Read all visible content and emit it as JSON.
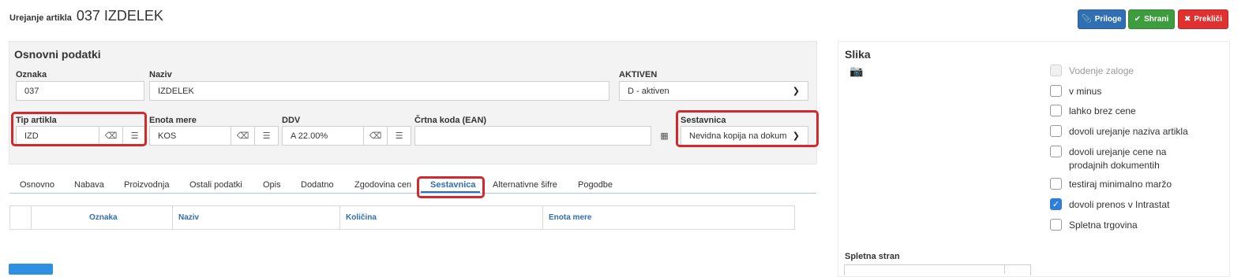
{
  "header": {
    "subtitle": "Urejanje artikla",
    "title": "037 IZDELEK"
  },
  "toolbar": {
    "attachments_label": "Priloge",
    "save_label": "Shrani",
    "cancel_label": "Prekliči"
  },
  "basic": {
    "section_title": "Osnovni podatki",
    "code_label": "Oznaka",
    "code_value": "037",
    "name_label": "Naziv",
    "name_value": "IZDELEK",
    "active_label": "AKTIVEN",
    "active_value": "D - aktiven",
    "type_label": "Tip artikla",
    "type_value": "IZD",
    "unit_label": "Enota mere",
    "unit_value": "KOS",
    "vat_label": "DDV",
    "vat_value": "A 22.00%",
    "barcode_label": "Črtna koda (EAN)",
    "barcode_value": "",
    "component_label": "Sestavnica",
    "component_value": "Nevidna kopija na dokum"
  },
  "tabs": [
    {
      "label": "Osnovno"
    },
    {
      "label": "Nabava"
    },
    {
      "label": "Proizvodnja"
    },
    {
      "label": "Ostali podatki"
    },
    {
      "label": "Opis"
    },
    {
      "label": "Dodatno"
    },
    {
      "label": "Zgodovina cen"
    },
    {
      "label": "Sestavnica",
      "active": true
    },
    {
      "label": "Alternativne šifre"
    },
    {
      "label": "Pogodbe"
    }
  ],
  "grid": {
    "columns": [
      "Oznaka",
      "Naziv",
      "Količina",
      "Enota mere"
    ]
  },
  "image_panel": {
    "title": "Slika",
    "icon": "camera-icon"
  },
  "options": [
    {
      "label": "Vodenje zaloge",
      "checked": false,
      "disabled": true
    },
    {
      "label": "v minus",
      "checked": false
    },
    {
      "label": "lahko brez cene",
      "checked": false
    },
    {
      "label": "dovoli urejanje naziva artikla",
      "checked": false
    },
    {
      "label": "dovoli urejanje cene na prodajnih dokumentih",
      "checked": false
    },
    {
      "label": "testiraj minimalno maržo",
      "checked": false
    },
    {
      "label": "dovoli prenos v Intrastat",
      "checked": true
    },
    {
      "label": "Spletna trgovina",
      "checked": false
    }
  ],
  "website": {
    "label": "Spletna stran"
  },
  "colors": {
    "primary": "#2f6fb2",
    "success": "#3d9c3d",
    "danger": "#e03131",
    "highlight": "#d3282c"
  }
}
